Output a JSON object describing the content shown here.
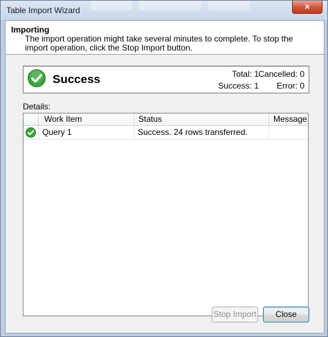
{
  "window": {
    "title": "Table Import Wizard",
    "close_glyph": "×"
  },
  "header": {
    "title": "Importing",
    "description": "The import operation might take several minutes to complete. To stop the import operation, click the Stop Import button."
  },
  "summary": {
    "status_icon": "success-check-icon",
    "status_text": "Success",
    "stats": {
      "total_label": "Total:",
      "total_value": "1",
      "cancelled_label": "Cancelled:",
      "cancelled_value": "0",
      "success_label": "Success:",
      "success_value": "1",
      "error_label": "Error:",
      "error_value": "0"
    }
  },
  "details": {
    "label": "Details:",
    "columns": [
      "Work Item",
      "Status",
      "Message"
    ],
    "rows": [
      {
        "icon": "success-check-icon",
        "work_item": "Query 1",
        "status": "Success. 24 rows transferred.",
        "message": ""
      }
    ]
  },
  "buttons": {
    "stop_import": "Stop Import",
    "close": "Close"
  },
  "colors": {
    "success_green": "#3aa53a",
    "window_frame": "#c9d7ea",
    "close_red": "#c4391b"
  }
}
